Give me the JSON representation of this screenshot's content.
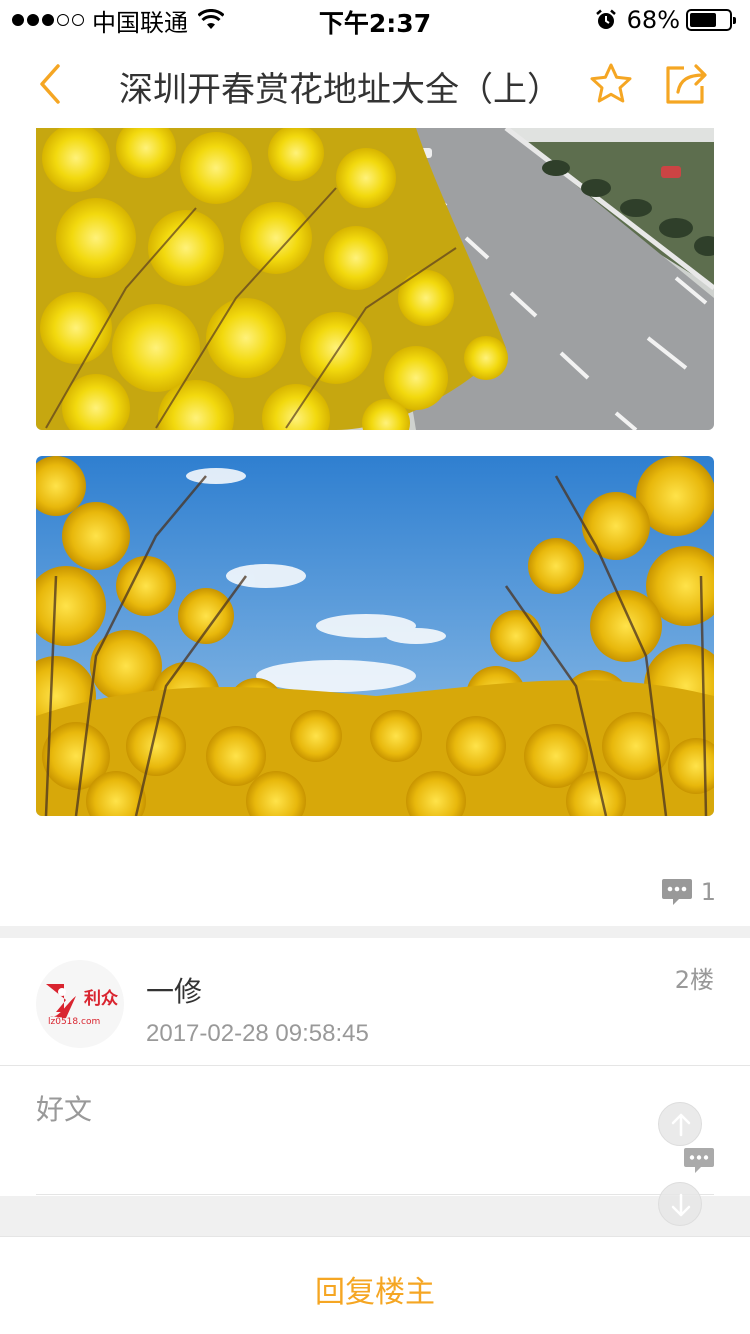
{
  "status_bar": {
    "carrier": "中国联通",
    "time": "下午2:37",
    "battery_percent": "68%",
    "battery_level": 0.68
  },
  "nav": {
    "title": "深圳开春赏花地址大全（上）",
    "back_icon": "chevron-left-icon",
    "favorite_icon": "star-icon",
    "share_icon": "share-icon"
  },
  "images": [
    {
      "name": "yellow-flowers-roadside"
    },
    {
      "name": "yellow-flowers-blue-sky"
    }
  ],
  "comments": {
    "count": "1",
    "icon": "comment-icon"
  },
  "reply": {
    "author": "一修",
    "timestamp": "2017-02-28 09:58:45",
    "floor": "2楼",
    "body": "好文",
    "avatar_logo_text": "利众",
    "avatar_logo_sub": "lz0518.com"
  },
  "bottom": {
    "reply_to_op": "回复楼主"
  },
  "colors": {
    "accent": "#f5a623",
    "muted_text": "#999999",
    "separator": "#f0f0f0"
  }
}
